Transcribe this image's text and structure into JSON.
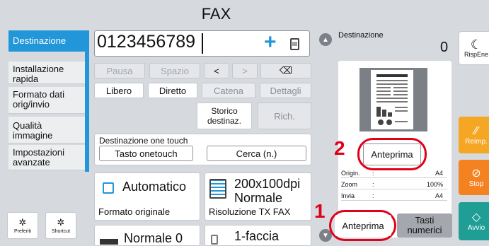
{
  "title": "FAX",
  "tabs": [
    {
      "label": "Destinazione"
    },
    {
      "label": "Installazione rapida"
    },
    {
      "label": "Formato dati orig/invio"
    },
    {
      "label": "Qualità immagine"
    },
    {
      "label": "Impostazioni avanzate"
    }
  ],
  "bottom_left": {
    "preferiti": "Preferiti",
    "shortcut": "Shortcut"
  },
  "entry": {
    "number": "0123456789"
  },
  "keys": {
    "pausa": "Pausa",
    "spazio": "Spazio",
    "left": "<",
    "right": ">",
    "backspace": "⌫"
  },
  "modes": {
    "libero": "Libero",
    "diretto": "Diretto",
    "catena": "Catena",
    "dettagli": "Dettagli"
  },
  "history": {
    "storico": "Storico destinaz.",
    "rich": "Rich."
  },
  "onetouch": {
    "label": "Destinazione one touch",
    "tasto": "Tasto onetouch",
    "cerca": "Cerca (n.)"
  },
  "cards": {
    "formato": {
      "value": "Automatico",
      "label": "Formato originale"
    },
    "risoluzione": {
      "value_line1": "200x100dpi",
      "value_line2": "Normale",
      "label": "Risoluzione TX FAX"
    },
    "densita": {
      "value": "Normale 0"
    },
    "fronte": {
      "value": "1-faccia"
    }
  },
  "right_panel": {
    "dest_label": "Destinazione",
    "dest_count": "0",
    "info": [
      {
        "key": "Origin.",
        "sep": ":",
        "value": "A4"
      },
      {
        "key": "Zoom",
        "sep": ":",
        "value": "100%"
      },
      {
        "key": "Invia",
        "sep": ":",
        "value": "A4"
      }
    ],
    "anteprima_top": "Anteprima",
    "anteprima_bottom": "Anteprima",
    "tasti": "Tasti numerici",
    "callout_1": "1",
    "callout_2": "2"
  },
  "side": {
    "risp": "RispEne",
    "reimp": "Reimp.",
    "stop": "Stop",
    "avvio": "Avvio"
  },
  "colors": {
    "accent": "#2196d8",
    "callout": "#e0001b",
    "reimp": "#f5a623",
    "stop": "#f58220",
    "avvio": "#1f9e96"
  }
}
